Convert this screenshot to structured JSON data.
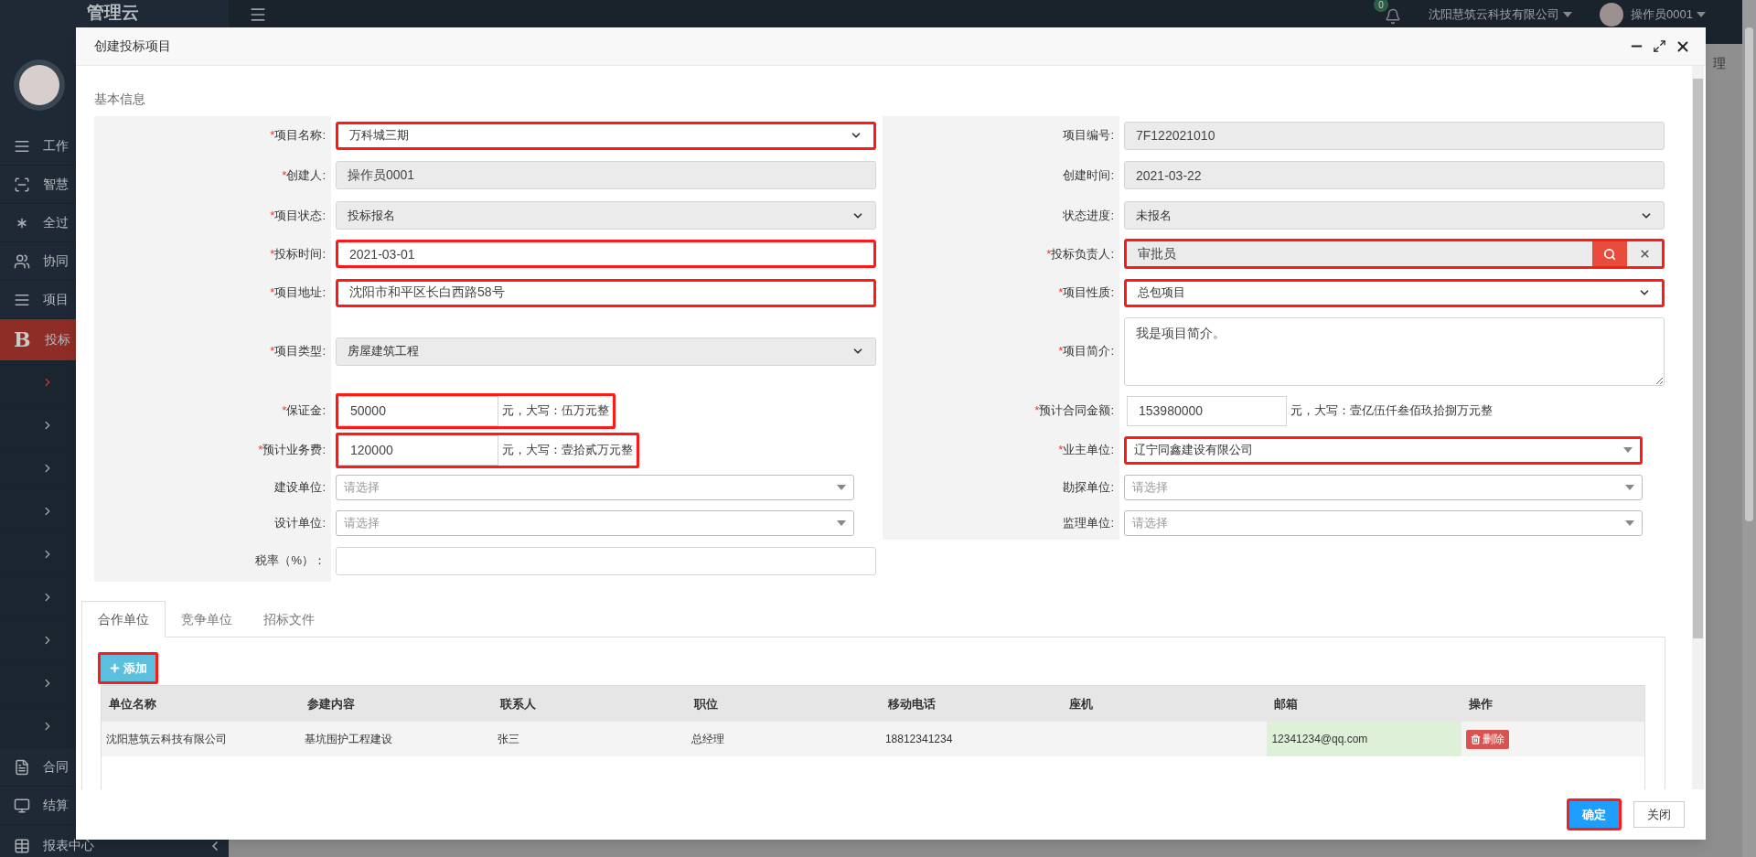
{
  "header": {
    "logo": "管理云",
    "notification_count": "0",
    "company": "沈阳慧筑云科技有限公司",
    "user": "操作员0001"
  },
  "sidebar": {
    "items": [
      {
        "label": "工作",
        "selected": false
      },
      {
        "label": "智慧",
        "selected": false
      },
      {
        "label": "全过",
        "selected": false
      },
      {
        "label": "协同",
        "selected": false
      },
      {
        "label": "项目",
        "selected": false
      },
      {
        "label": "投标",
        "icon_text": "B",
        "selected": true,
        "children": [
          {
            "selected": true
          },
          {
            "selected": false
          },
          {
            "selected": false
          },
          {
            "selected": false
          },
          {
            "selected": false
          },
          {
            "selected": false
          },
          {
            "selected": false
          },
          {
            "selected": false
          },
          {
            "selected": false
          }
        ]
      },
      {
        "label": "合同",
        "selected": false
      },
      {
        "label": "结算",
        "selected": false
      },
      {
        "label": "报表中心",
        "selected": false,
        "collapse": true
      }
    ]
  },
  "page_tab": "理",
  "modal": {
    "title": "创建投标项目",
    "section": "基本信息",
    "rows": [
      {
        "left": {
          "mark": "*",
          "label": "项目名称:",
          "kind": "select",
          "value": "万科城三期",
          "disabled": false,
          "highlighted": true
        },
        "right": {
          "label": "项目编号:",
          "kind": "input",
          "value": "7F122021010",
          "readonly": true,
          "highlighted": false
        }
      },
      {
        "left": {
          "mark": "*",
          "label": "创建人:",
          "kind": "input",
          "value": "操作员0001",
          "readonly": true,
          "highlighted": false
        },
        "right": {
          "label": "创建时间:",
          "kind": "input",
          "value": "2021-03-22",
          "readonly": true,
          "highlighted": false
        }
      },
      {
        "left": {
          "mark": "*",
          "label": "项目状态:",
          "kind": "select",
          "value": "投标报名",
          "disabled": true,
          "highlighted": false
        },
        "right": {
          "label": "状态进度:",
          "kind": "select",
          "value": "未报名",
          "disabled": true,
          "highlighted": false
        }
      },
      {
        "left": {
          "mark": "*",
          "label": "投标时间:",
          "kind": "input",
          "value": "2021-03-01",
          "readonly": false,
          "highlighted": true
        },
        "right": {
          "mark": "*",
          "label": "投标负责人:",
          "kind": "lookup",
          "value": "审批员",
          "readonly": true,
          "highlighted": true
        }
      },
      {
        "left": {
          "mark": "*",
          "label": "项目地址:",
          "kind": "input",
          "value": "沈阳市和平区长白西路58号",
          "readonly": false,
          "highlighted": true
        },
        "right": {
          "mark": "*",
          "label": "项目性质:",
          "kind": "select",
          "value": "总包项目",
          "disabled": false,
          "highlighted": true
        }
      },
      {
        "left": {
          "mark": "*",
          "label": "项目类型:",
          "kind": "select",
          "value": "房屋建筑工程",
          "disabled": true,
          "highlighted": false
        },
        "right": {
          "mark": "*",
          "label": "项目简介:",
          "kind": "textarea",
          "value": "我是项目简介。",
          "highlighted": false
        }
      },
      {
        "left": {
          "mark": "*",
          "label": "保证金:",
          "kind": "amount",
          "value": "50000",
          "suffix": "元，大写：伍万元整",
          "highlighted": true
        },
        "right": {
          "mark": "*",
          "label": "预计合同金额:",
          "kind": "amount",
          "value": "153980000",
          "suffix": "元，大写：壹亿伍仟叁佰玖拾捌万元整",
          "highlighted": false
        }
      },
      {
        "left": {
          "mark": "*",
          "label": "预计业务费:",
          "kind": "amount",
          "value": "120000",
          "suffix": "元，大写：壹拾贰万元整",
          "highlighted": true
        },
        "right": {
          "mark": "*",
          "label": "业主单位:",
          "kind": "combo",
          "value": "辽宁同鑫建设有限公司",
          "highlighted": true
        }
      },
      {
        "left": {
          "label": "建设单位:",
          "kind": "combo",
          "placeholder": "请选择",
          "highlighted": false
        },
        "right": {
          "label": "勘探单位:",
          "kind": "combo",
          "placeholder": "请选择",
          "highlighted": false
        }
      },
      {
        "left": {
          "label": "设计单位:",
          "kind": "combo",
          "placeholder": "请选择",
          "highlighted": false
        },
        "right": {
          "label": "监理单位:",
          "kind": "combo",
          "placeholder": "请选择",
          "highlighted": false
        }
      },
      {
        "left": {
          "label": "税率（%）：",
          "kind": "input",
          "readonly": false,
          "highlighted": false
        }
      }
    ],
    "tabs": [
      {
        "label": "合作单位",
        "selected": true
      },
      {
        "label": "竞争单位",
        "selected": false
      },
      {
        "label": "招标文件",
        "selected": false
      }
    ],
    "add_button": {
      "label": "添加",
      "highlighted": true
    },
    "table": {
      "columns": [
        "单位名称",
        "参建内容",
        "联系人",
        "职位",
        "移动电话",
        "座机",
        "邮箱",
        "操作"
      ],
      "rows": [
        {
          "cells": [
            {
              "text": "沈阳慧筑云科技有限公司",
              "highlighted": false
            },
            {
              "text": "基坑围护工程建设",
              "highlighted": false
            },
            {
              "text": "张三",
              "highlighted": false
            },
            {
              "text": "总经理",
              "highlighted": false
            },
            {
              "text": "18812341234",
              "highlighted": false
            },
            {
              "highlighted": false
            },
            {
              "text": "12341234@qq.com",
              "highlighted": true
            }
          ],
          "action": "删除"
        }
      ]
    },
    "buttons": [
      {
        "label": "确定",
        "kind": "primary",
        "highlighted": true
      },
      {
        "label": "关闭",
        "kind": "default",
        "highlighted": false
      }
    ]
  }
}
